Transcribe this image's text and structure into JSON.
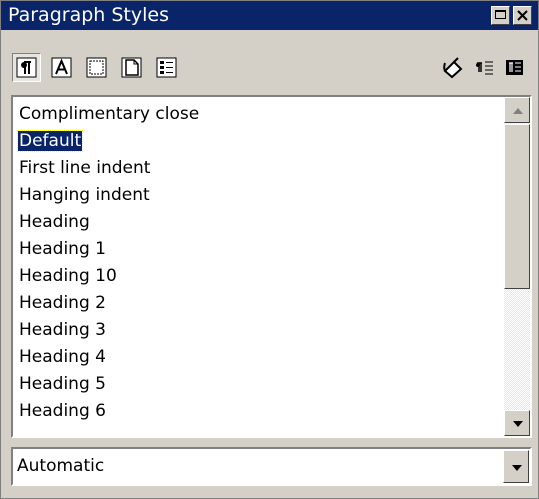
{
  "window": {
    "title": "Paragraph Styles"
  },
  "toolbar": {
    "left_icons": [
      "paragraph-styles-icon",
      "character-styles-icon",
      "frame-styles-icon",
      "page-styles-icon",
      "numbering-styles-icon"
    ],
    "right_icons": [
      "fill-format-mode-icon",
      "new-style-from-selection-icon",
      "update-style-icon"
    ],
    "pressed": "paragraph-styles-icon"
  },
  "styles_list": {
    "items": [
      "Complimentary close",
      "Default",
      "First line indent",
      "Hanging indent",
      "Heading",
      "Heading 1",
      "Heading 10",
      "Heading 2",
      "Heading 3",
      "Heading 4",
      "Heading 5",
      "Heading 6"
    ],
    "selected": "Default"
  },
  "filter": {
    "value": "Automatic"
  },
  "colors": {
    "titlebar": "#0a246a",
    "selection": "#0a246a",
    "face": "#d4d0c8"
  }
}
